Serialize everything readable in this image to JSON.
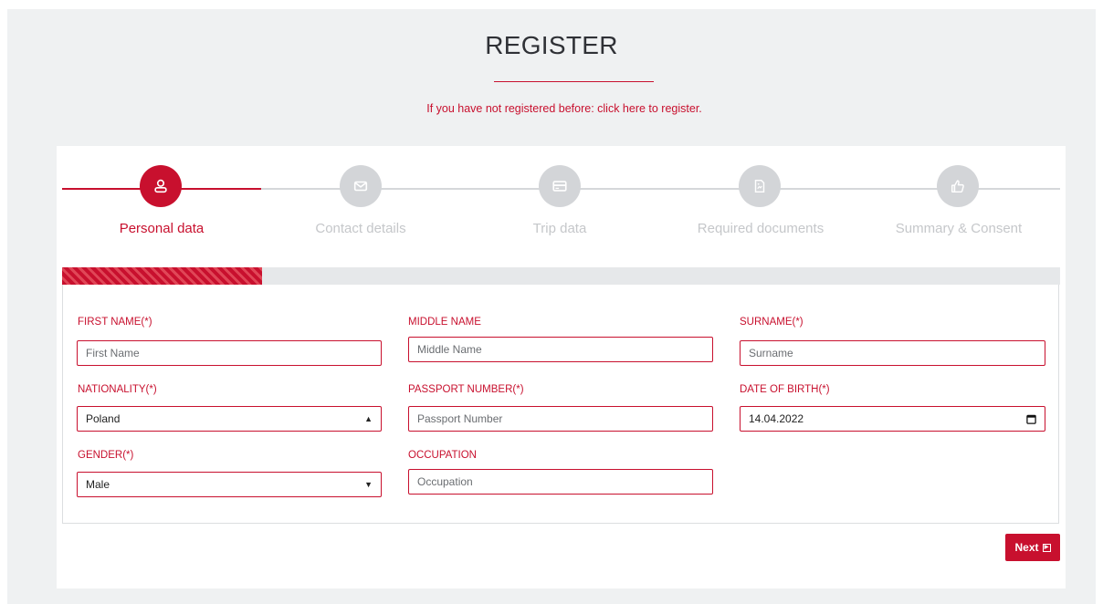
{
  "header": {
    "title": "REGISTER",
    "register_prompt": "If you have not registered before: click here to register."
  },
  "steps": [
    {
      "label": "Personal data",
      "icon": "user-icon",
      "active": true
    },
    {
      "label": "Contact details",
      "icon": "envelope-icon",
      "active": false
    },
    {
      "label": "Trip data",
      "icon": "credit-card-icon",
      "active": false
    },
    {
      "label": "Required documents",
      "icon": "document-icon",
      "active": false
    },
    {
      "label": "Summary & Consent",
      "icon": "thumbs-up-icon",
      "active": false
    }
  ],
  "progress": {
    "completed_fraction": 0.2
  },
  "form": {
    "first_name": {
      "label": "FIRST NAME(*)",
      "placeholder": "First Name",
      "value": ""
    },
    "middle_name": {
      "label": "MIDDLE NAME",
      "placeholder": "Middle Name",
      "value": ""
    },
    "surname": {
      "label": "SURNAME(*)",
      "placeholder": "Surname",
      "value": ""
    },
    "nationality": {
      "label": "NATIONALITY(*)",
      "value": "Poland"
    },
    "passport_number": {
      "label": "PASSPORT NUMBER(*)",
      "placeholder": "Passport Number",
      "value": ""
    },
    "date_of_birth": {
      "label": "DATE OF BIRTH(*)",
      "value": "14.04.2022"
    },
    "gender": {
      "label": "GENDER(*)",
      "value": "Male"
    },
    "occupation": {
      "label": "OCCUPATION",
      "placeholder": "Occupation",
      "value": ""
    }
  },
  "actions": {
    "next_label": "Next"
  },
  "colors": {
    "accent": "#c8102e",
    "inactive": "#d3d5d8",
    "background": "#eff1f2"
  }
}
